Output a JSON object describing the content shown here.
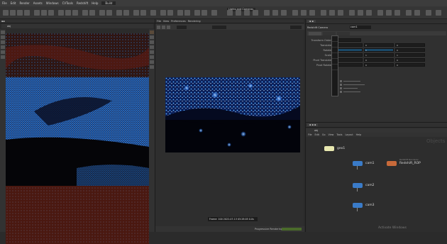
{
  "menubar": {
    "items": [
      "File",
      "Edit",
      "Render",
      "Assets",
      "Windows",
      "CVTools",
      "Redshift",
      "Help"
    ],
    "desktop_label": "Build"
  },
  "right_toolbar": {
    "label": "Lights and Cameras"
  },
  "left_viewer": {
    "path_label": "obj"
  },
  "center_viewer": {
    "menu": [
      "File",
      "View",
      "Preferences",
      "Rendering"
    ],
    "status_text": "Frame: 100 2022-07-13 05:28:05 0.0s",
    "footer_label": "Progressive Rendering"
  },
  "params": {
    "node_type": "Redshift Camera",
    "node_name": "cam1",
    "rows": [
      {
        "label": "Transform Order"
      },
      {
        "label": "Translate",
        "values": [
          "0",
          "0",
          "0"
        ]
      },
      {
        "label": "Rotate",
        "values": [
          "-",
          "0",
          "0"
        ]
      },
      {
        "label": "Scale",
        "values": [
          "1",
          "1",
          "1"
        ]
      },
      {
        "label": "Pivot Translate",
        "values": [
          "0",
          "0",
          "0"
        ]
      },
      {
        "label": "Pivot Rotate",
        "values": [
          "0",
          "0",
          "0"
        ]
      }
    ]
  },
  "network": {
    "path": "obj",
    "menu": [
      "File",
      "Edit",
      "Go",
      "View",
      "Tools",
      "Layout",
      "Help"
    ],
    "watermark": "Objects",
    "nodes": [
      {
        "name": "geo1"
      },
      {
        "name": "cam1"
      },
      {
        "name": "Redshift_ROP",
        "subtitle": "Redshift Renderer"
      },
      {
        "name": "cam2"
      },
      {
        "name": "cam3"
      }
    ]
  },
  "system": {
    "activate_text": "Activate Windows"
  },
  "colors": {
    "accent": "#1e6fd9",
    "node_geo": "#e8e8b0",
    "node_cam": "#3a7bc8",
    "node_rop": "#c86a3a"
  }
}
